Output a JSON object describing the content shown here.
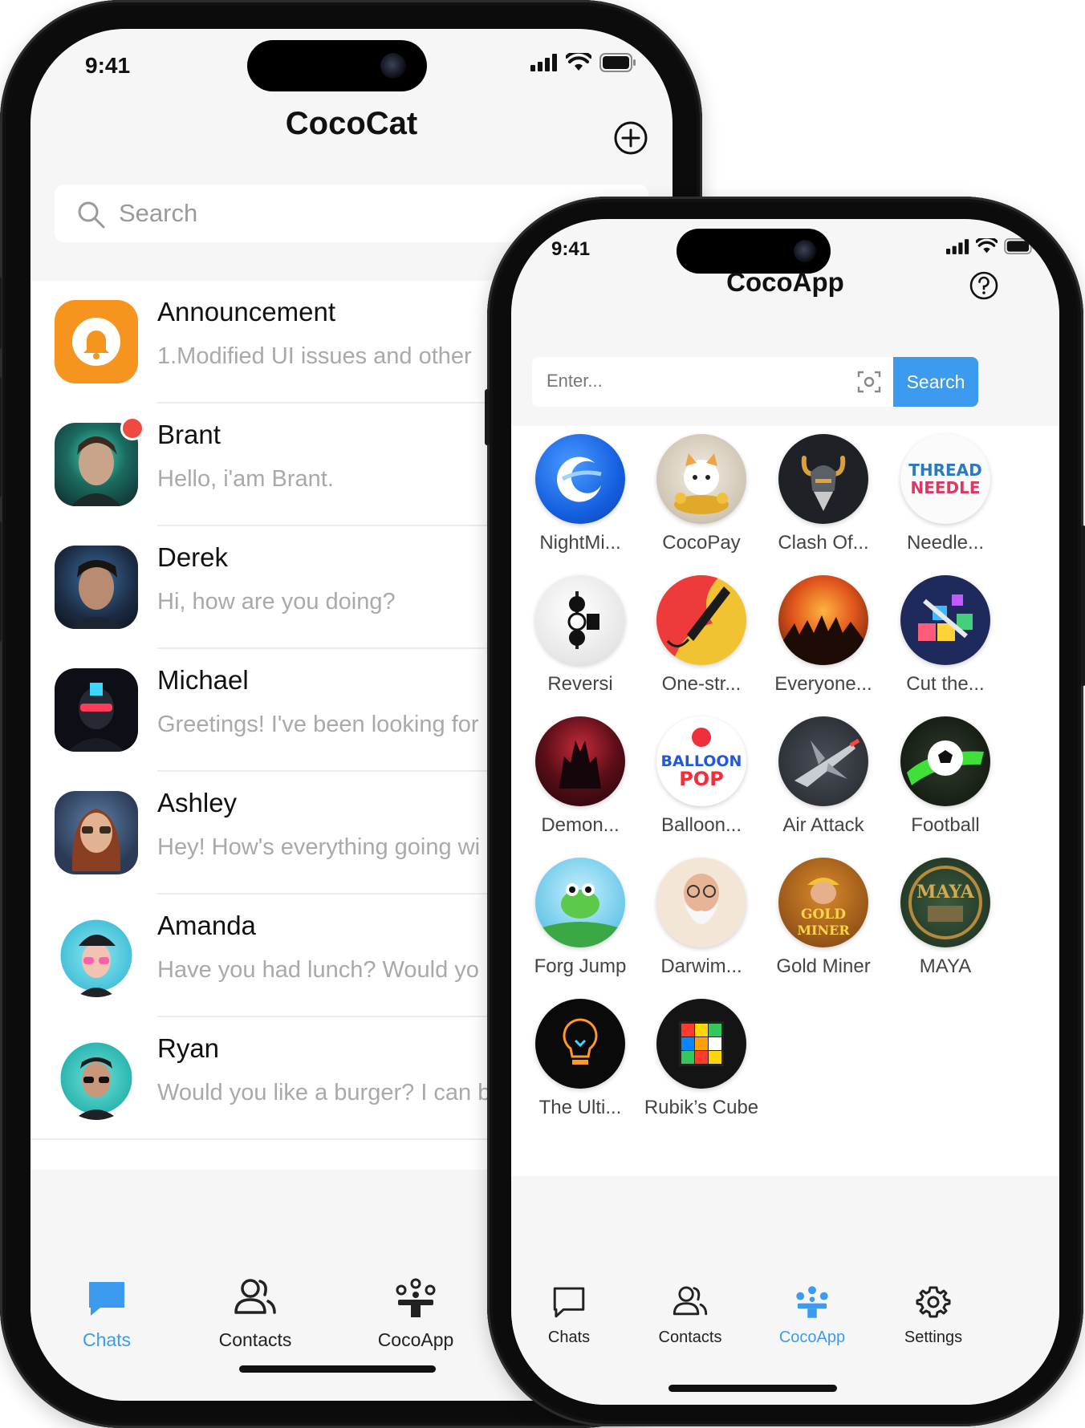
{
  "colors": {
    "accent": "#3d9bef",
    "announcement": "#f5951f",
    "unread_dot": "#ee4a3f",
    "search_button": "#3d9bef"
  },
  "phone_chats": {
    "status": {
      "time": "9:41"
    },
    "header": {
      "title": "CocoCat",
      "add_icon": "plus-circle-icon"
    },
    "search": {
      "placeholder": "Search"
    },
    "chats": [
      {
        "name": "Announcement",
        "message": "1.Modified UI issues and other"
      },
      {
        "name": "Brant",
        "message": "Hello, i'am Brant.",
        "unread": true
      },
      {
        "name": "Derek",
        "message": "Hi, how are you doing?"
      },
      {
        "name": "Michael",
        "message": "Greetings! I've been looking for"
      },
      {
        "name": "Ashley",
        "message": "Hey! How's everything going wi"
      },
      {
        "name": "Amanda",
        "message": "Have you had lunch? Would yo"
      },
      {
        "name": "Ryan",
        "message": "Would you like a burger? I can b"
      }
    ],
    "tabs": [
      {
        "label": "Chats",
        "icon": "chat-bubble-icon",
        "active": true
      },
      {
        "label": "Contacts",
        "icon": "contacts-icon",
        "active": false
      },
      {
        "label": "CocoApp",
        "icon": "apps-icon",
        "active": false
      }
    ]
  },
  "phone_apps": {
    "status": {
      "time": "9:41"
    },
    "header": {
      "title": "CocoApp",
      "help_icon": "help-icon"
    },
    "search": {
      "placeholder": "Enter...",
      "button_label": "Search",
      "scan_icon": "scan-icon"
    },
    "apps": [
      {
        "label": "NightMi..."
      },
      {
        "label": "CocoPay"
      },
      {
        "label": "Clash Of..."
      },
      {
        "label": "Needle..."
      },
      {
        "label": "Reversi"
      },
      {
        "label": "One-str..."
      },
      {
        "label": "Everyone..."
      },
      {
        "label": "Cut the..."
      },
      {
        "label": "Demon..."
      },
      {
        "label": "Balloon..."
      },
      {
        "label": "Air Attack"
      },
      {
        "label": "Football"
      },
      {
        "label": "Forg Jump"
      },
      {
        "label": "Darwim..."
      },
      {
        "label": "Gold Miner"
      },
      {
        "label": "MAYA"
      },
      {
        "label": "The Ulti..."
      },
      {
        "label": "Rubik’s Cube"
      }
    ],
    "tabs": [
      {
        "label": "Chats",
        "icon": "chat-bubble-icon",
        "active": false
      },
      {
        "label": "Contacts",
        "icon": "contacts-icon",
        "active": false
      },
      {
        "label": "CocoApp",
        "icon": "apps-icon",
        "active": true
      },
      {
        "label": "Settings",
        "icon": "gear-icon",
        "active": false
      }
    ]
  },
  "app_icon_texts": {
    "needle": "THREAD NEEDLE",
    "balloon": "BALLOON POP",
    "gold": "GOLD MINER",
    "maya": "MAYA"
  }
}
